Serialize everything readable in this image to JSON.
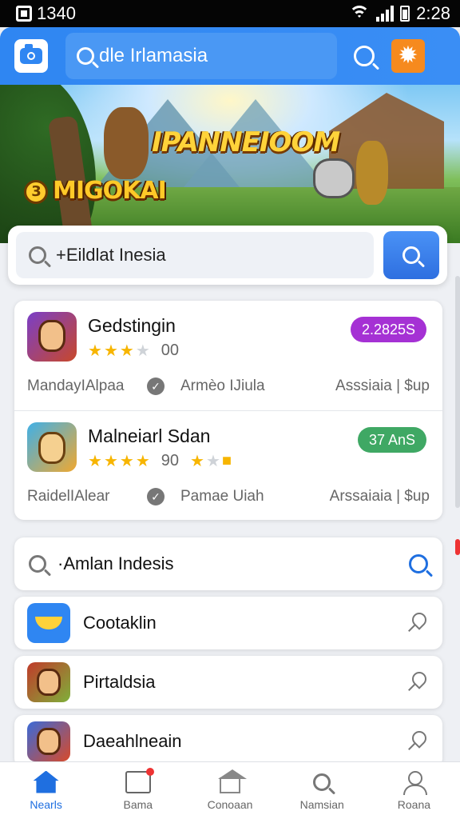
{
  "status_bar": {
    "time_left": "1340",
    "time_right": "2:28"
  },
  "header": {
    "search_text": "dle Irlamasia",
    "settings_glyph": "✹"
  },
  "banner": {
    "title": "IPANNEIOOM",
    "subtitle": "MIGOKAI",
    "coin_glyph": "3"
  },
  "search_bar": {
    "text": "+Eildlat Inesia"
  },
  "apps": [
    {
      "name": "Gedstingin",
      "stars": 3,
      "rating_text": "00",
      "badge": "2.2825S",
      "badge_color": "#a531d4",
      "meta_left": "MandayIAlpaa",
      "meta_mid": "Armèo IJiula",
      "meta_right": "Asssiaia | $up"
    },
    {
      "name": "Malneiarl Sdan",
      "stars": 4,
      "rating_text": "90",
      "badge": "37 AnS",
      "badge_color": "#3fa864",
      "meta_left": "RaidelIAlear",
      "meta_mid": "Pamae Uiah",
      "meta_right": "Arssaiaia | $up"
    }
  ],
  "secondary_search": {
    "text": "·Amlan Indesis"
  },
  "list_rows": [
    {
      "label": "Cootaklin",
      "icon": "banana-icon"
    },
    {
      "label": "Pirtaldsia",
      "icon": "hero-icon"
    },
    {
      "label": "Daeahlneain",
      "icon": "hero-icon"
    }
  ],
  "bottom_nav": [
    {
      "label": "Nearls",
      "icon": "home-icon",
      "active": true
    },
    {
      "label": "Bama",
      "icon": "box-icon",
      "active": false
    },
    {
      "label": "Conoaan",
      "icon": "building-icon",
      "active": false
    },
    {
      "label": "Namsian",
      "icon": "search-icon",
      "active": false
    },
    {
      "label": "Roana",
      "icon": "user-icon",
      "active": false
    }
  ]
}
